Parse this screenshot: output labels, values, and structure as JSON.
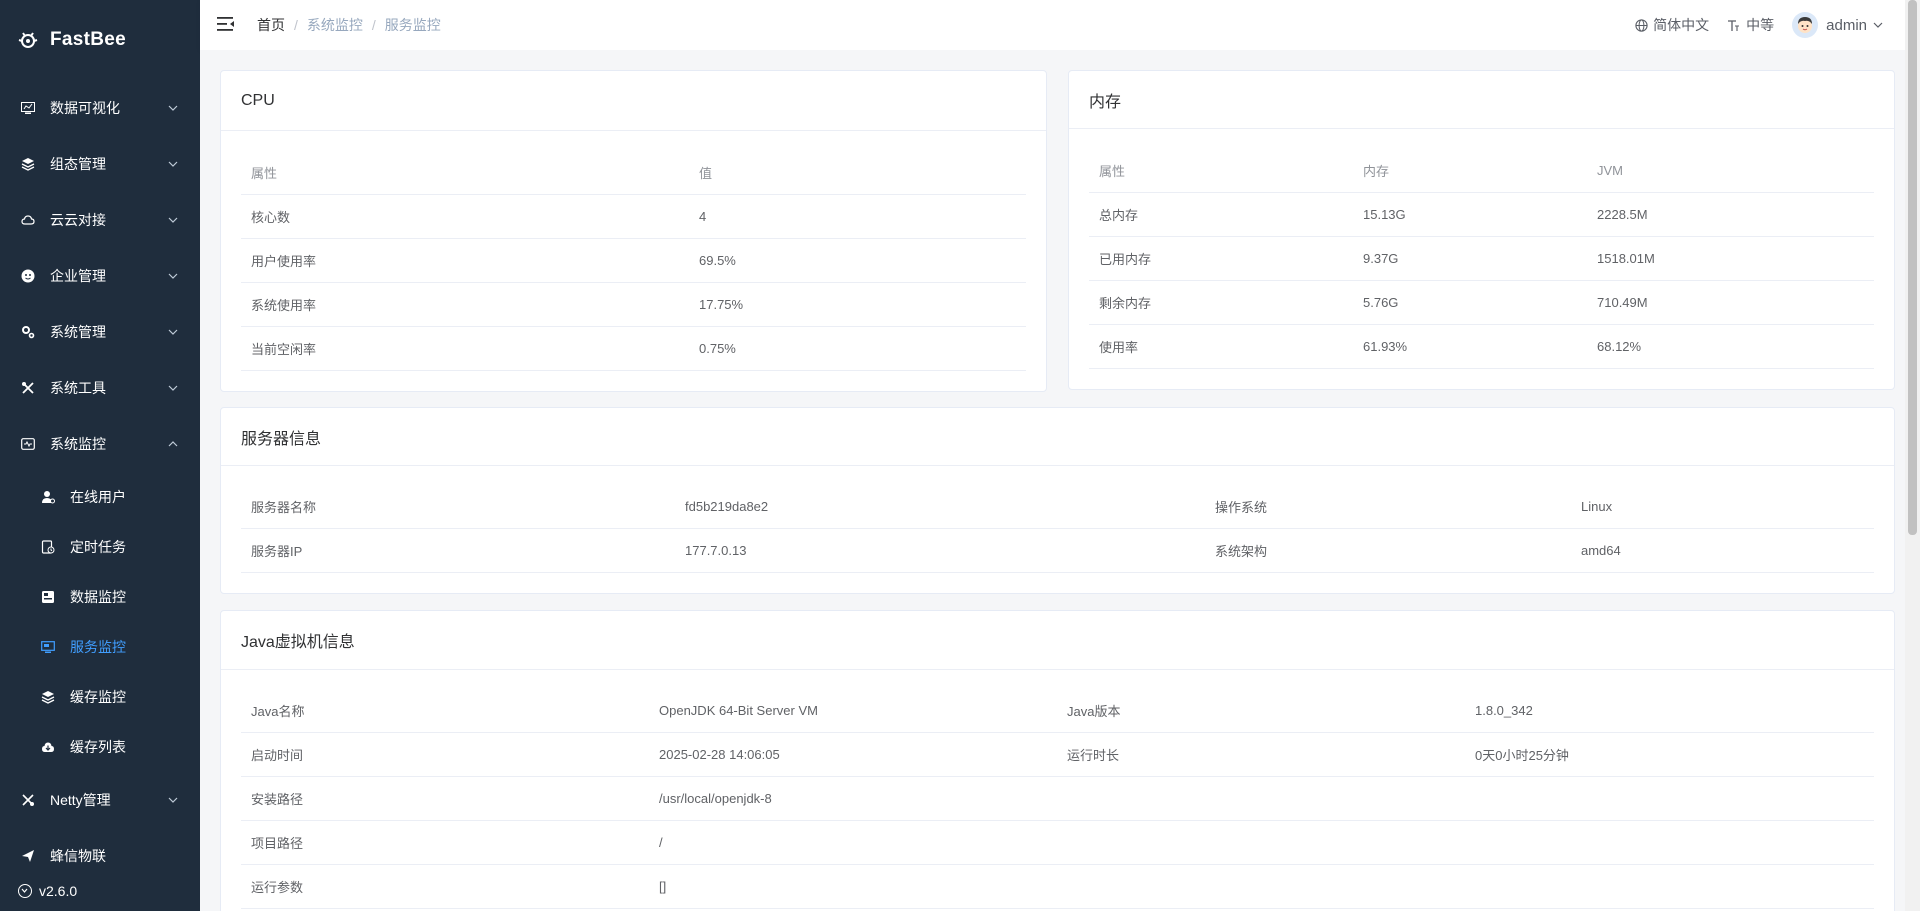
{
  "app": {
    "name": "FastBee",
    "version": "v2.6.0"
  },
  "sidebar": {
    "items": [
      {
        "label": "数据可视化",
        "icon": "dashboard-icon"
      },
      {
        "label": "组态管理",
        "icon": "layers-icon"
      },
      {
        "label": "云云对接",
        "icon": "cloud-icon"
      },
      {
        "label": "企业管理",
        "icon": "enterprise-icon"
      },
      {
        "label": "系统管理",
        "icon": "settings-icon"
      },
      {
        "label": "系统工具",
        "icon": "tools-icon"
      },
      {
        "label": "系统监控",
        "icon": "monitor-icon"
      }
    ],
    "submenu": [
      {
        "label": "在线用户",
        "icon": "online-user-icon"
      },
      {
        "label": "定时任务",
        "icon": "scheduled-task-icon"
      },
      {
        "label": "数据监控",
        "icon": "data-monitor-icon"
      },
      {
        "label": "服务监控",
        "icon": "server-monitor-icon"
      },
      {
        "label": "缓存监控",
        "icon": "cache-monitor-icon"
      },
      {
        "label": "缓存列表",
        "icon": "cache-list-icon"
      }
    ],
    "after": [
      {
        "label": "Netty管理",
        "icon": "netty-icon"
      },
      {
        "label": "蜂信物联",
        "icon": "send-icon"
      }
    ]
  },
  "header": {
    "breadcrumb": [
      "首页",
      "系统监控",
      "服务监控"
    ],
    "language": "简体中文",
    "size": "中等",
    "user": "admin"
  },
  "cpu": {
    "title": "CPU",
    "headers": [
      "属性",
      "值"
    ],
    "rows": [
      [
        "核心数",
        "4"
      ],
      [
        "用户使用率",
        "69.5%"
      ],
      [
        "系统使用率",
        "17.75%"
      ],
      [
        "当前空闲率",
        "0.75%"
      ]
    ]
  },
  "memory": {
    "title": "内存",
    "headers": [
      "属性",
      "内存",
      "JVM"
    ],
    "rows": [
      [
        "总内存",
        "15.13G",
        "2228.5M"
      ],
      [
        "已用内存",
        "9.37G",
        "1518.01M"
      ],
      [
        "剩余内存",
        "5.76G",
        "710.49M"
      ],
      [
        "使用率",
        "61.93%",
        "68.12%"
      ]
    ]
  },
  "server": {
    "title": "服务器信息",
    "rows": [
      [
        "服务器名称",
        "fd5b219da8e2",
        "操作系统",
        "Linux"
      ],
      [
        "服务器IP",
        "177.7.0.13",
        "系统架构",
        "amd64"
      ]
    ]
  },
  "jvm": {
    "title": "Java虚拟机信息",
    "rows": [
      [
        "Java名称",
        "OpenJDK 64-Bit Server VM",
        "Java版本",
        "1.8.0_342"
      ],
      [
        "启动时间",
        "2025-02-28 14:06:05",
        "运行时长",
        "0天0小时25分钟"
      ],
      [
        "安装路径",
        "/usr/local/openjdk-8"
      ],
      [
        "项目路径",
        "/"
      ],
      [
        "运行参数",
        "[]"
      ]
    ]
  },
  "colors": {
    "sidebar": "#1f2d3d",
    "active": "#409eff"
  }
}
